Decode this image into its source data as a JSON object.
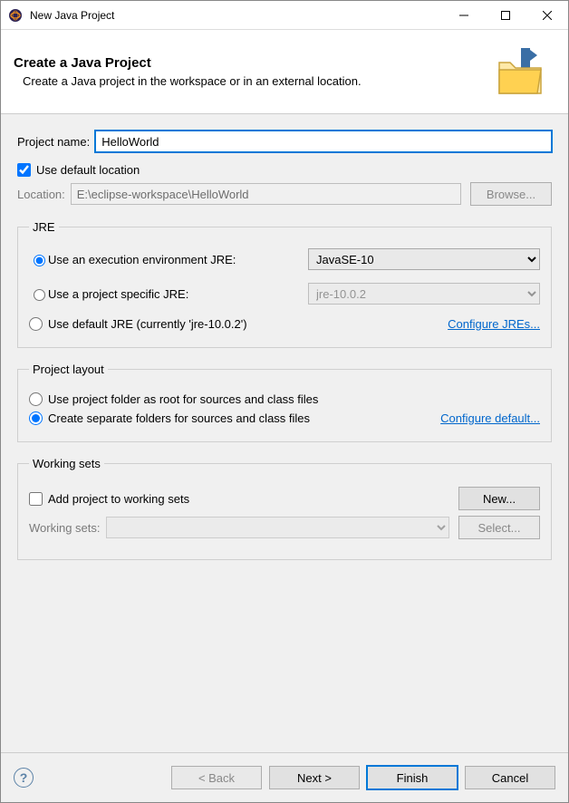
{
  "window": {
    "title": "New Java Project"
  },
  "header": {
    "title": "Create a Java Project",
    "subtitle": "Create a Java project in the workspace or in an external location."
  },
  "project": {
    "name_label": "Project name:",
    "name_value": "HelloWorld",
    "use_default_location_label": "Use default location",
    "use_default_location_checked": true,
    "location_label": "Location:",
    "location_value": "E:\\eclipse-workspace\\HelloWorld",
    "browse_label": "Browse..."
  },
  "jre": {
    "legend": "JRE",
    "option_exec_env_label": "Use an execution environment JRE:",
    "exec_env_value": "JavaSE-10",
    "option_project_specific_label": "Use a project specific JRE:",
    "project_specific_value": "jre-10.0.2",
    "option_default_label": "Use default JRE (currently 'jre-10.0.2')",
    "configure_link": "Configure JREs...",
    "selected": "exec_env"
  },
  "layout": {
    "legend": "Project layout",
    "option_root_label": "Use project folder as root for sources and class files",
    "option_separate_label": "Create separate folders for sources and class files",
    "configure_link": "Configure default...",
    "selected": "separate"
  },
  "working_sets": {
    "legend": "Working sets",
    "add_label": "Add project to working sets",
    "new_label": "New...",
    "sets_label": "Working sets:",
    "select_label": "Select...",
    "add_checked": false
  },
  "buttons": {
    "back": "< Back",
    "next": "Next >",
    "finish": "Finish",
    "cancel": "Cancel"
  },
  "icons": {
    "app": "eclipse-icon",
    "wizard": "folder-java-icon"
  }
}
